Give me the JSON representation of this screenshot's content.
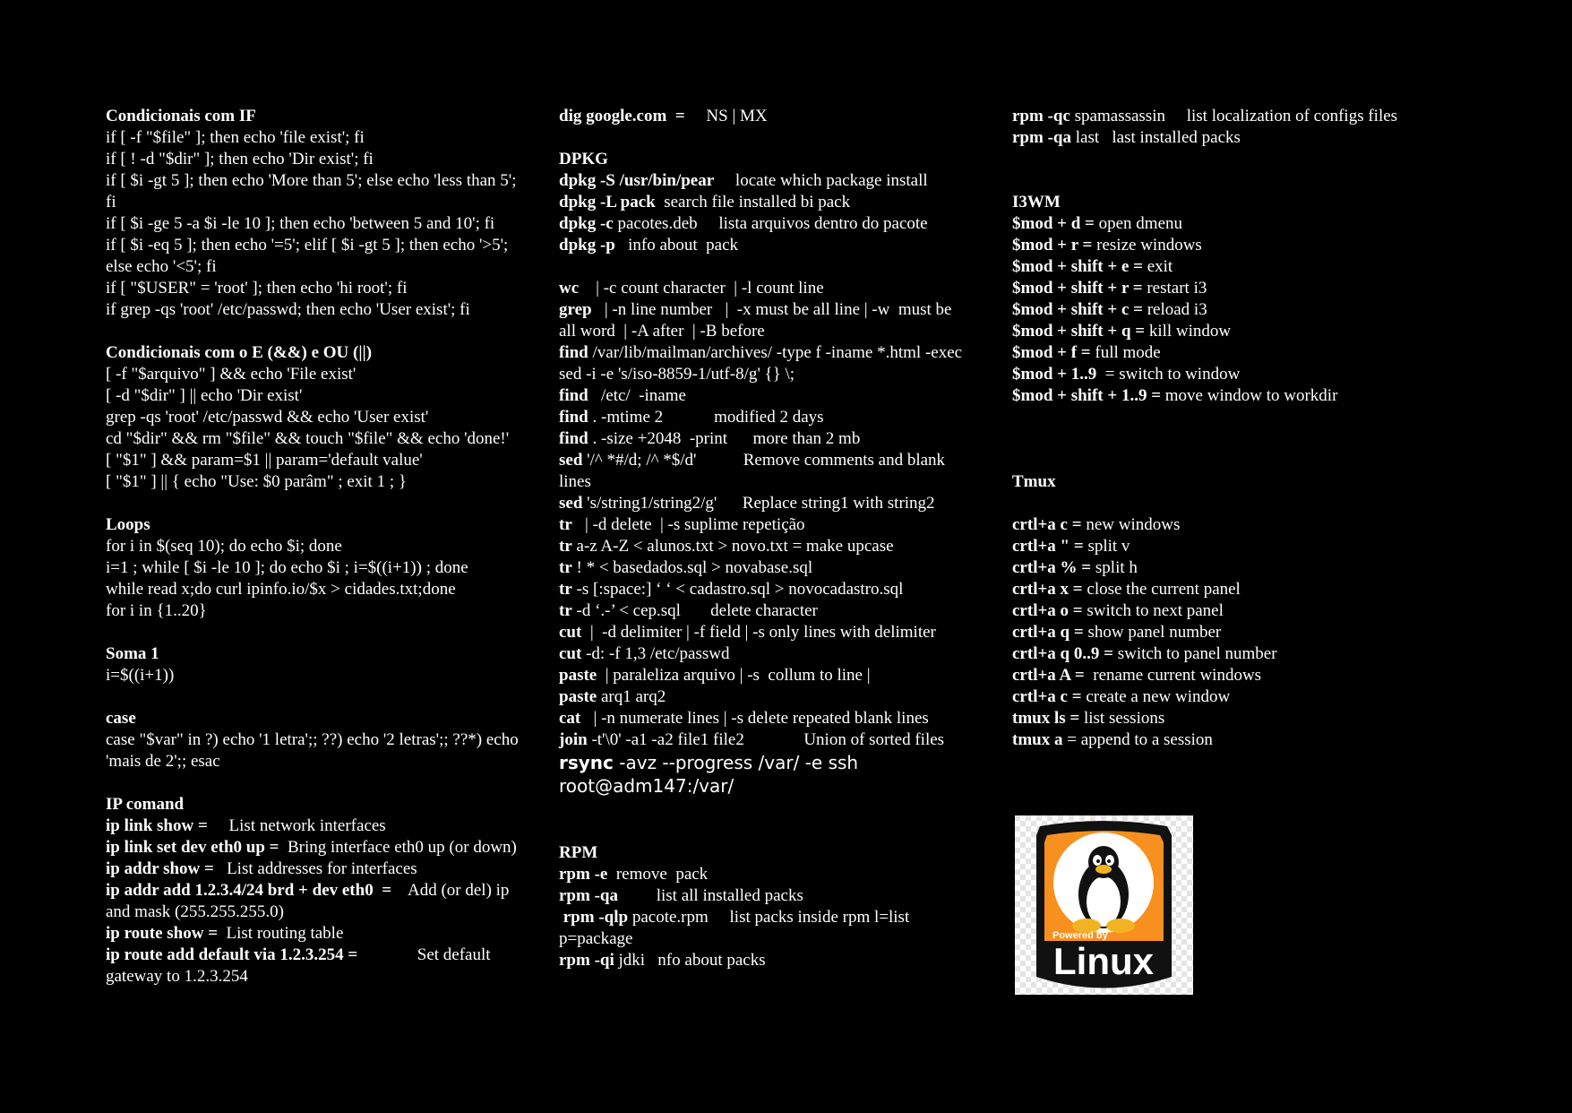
{
  "col1": {
    "lines": [
      {
        "b": "Condicionais com IF",
        "t": ""
      },
      {
        "b": "",
        "t": "if [ -f \"$file\" ]; then echo 'file exist'; fi"
      },
      {
        "b": "",
        "t": "if [ ! -d \"$dir\" ]; then echo 'Dir exist'; fi"
      },
      {
        "b": "",
        "t": "if [ $i -gt 5 ]; then echo 'More than 5'; else echo 'less than 5';"
      },
      {
        "b": "",
        "t": "fi"
      },
      {
        "b": "",
        "t": "if [ $i -ge 5 -a $i -le 10 ]; then echo 'between 5 and 10'; fi"
      },
      {
        "b": "",
        "t": "if [ $i -eq 5 ]; then echo '=5'; elif [ $i -gt 5 ]; then echo '>5';"
      },
      {
        "b": "",
        "t": "else echo '<5'; fi"
      },
      {
        "b": "",
        "t": "if [ \"$USER\" = 'root' ]; then echo 'hi root'; fi"
      },
      {
        "b": "",
        "t": "if grep -qs 'root' /etc/passwd; then echo 'User exist'; fi"
      },
      {
        "b": "",
        "t": ""
      },
      {
        "b": "Condicionais com o E (&&) e OU (||)",
        "t": ""
      },
      {
        "b": "",
        "t": "[ -f \"$arquivo\" ] && echo 'File exist'"
      },
      {
        "b": "",
        "t": "[ -d \"$dir\" ] || echo 'Dir exist'"
      },
      {
        "b": "",
        "t": "grep -qs 'root' /etc/passwd && echo 'User exist'"
      },
      {
        "b": "",
        "t": "cd \"$dir\" && rm \"$file\" && touch \"$file\" && echo 'done!'"
      },
      {
        "b": "",
        "t": "[ \"$1\" ] && param=$1 || param='default value'"
      },
      {
        "b": "",
        "t": "[ \"$1\" ] || { echo \"Use: $0 parâm\" ; exit 1 ; }"
      },
      {
        "b": "",
        "t": ""
      },
      {
        "b": "Loops",
        "t": ""
      },
      {
        "b": "",
        "t": "for i in $(seq 10); do echo $i; done"
      },
      {
        "b": "",
        "t": "i=1 ; while [ $i -le 10 ]; do echo $i ; i=$((i+1)) ; done"
      },
      {
        "b": "",
        "t": "while read x;do curl ipinfo.io/$x > cidades.txt;done"
      },
      {
        "b": "",
        "t": "for i in {1..20}"
      },
      {
        "b": "",
        "t": ""
      },
      {
        "b": "Soma 1",
        "t": ""
      },
      {
        "b": "",
        "t": "i=$((i+1))"
      },
      {
        "b": "",
        "t": ""
      },
      {
        "b": "case",
        "t": ""
      },
      {
        "b": "",
        "t": "case \"$var\" in ?) echo '1 letra';; ??) echo '2 letras';; ??*) echo"
      },
      {
        "b": "",
        "t": "'mais de 2';; esac"
      },
      {
        "b": "",
        "t": ""
      },
      {
        "b": "IP comand",
        "t": ""
      },
      {
        "b": "ip link show = ",
        "t": "    List network interfaces"
      },
      {
        "b": "ip link set dev eth0 up = ",
        "t": " Bring interface eth0 up (or down)"
      },
      {
        "b": "ip addr show = ",
        "t": "  List addresses for interfaces"
      },
      {
        "b": "ip addr add 1.2.3.4/24 brd + dev eth0  = ",
        "t": "   Add (or del) ip"
      },
      {
        "b": "",
        "t": "and mask (255.255.255.0)"
      },
      {
        "b": "ip route show = ",
        "t": " List routing table"
      },
      {
        "b": "ip route add default via 1.2.3.254 = ",
        "t": "             Set default"
      },
      {
        "b": "",
        "t": "gateway to 1.2.3.254"
      }
    ]
  },
  "col2": {
    "lines": [
      {
        "b": "dig google.com  = ",
        "t": "    NS | MX"
      },
      {
        "b": "",
        "t": ""
      },
      {
        "b": "DPKG",
        "t": ""
      },
      {
        "b": "dpkg -S /usr/bin/pear",
        "t": "     locate which package install"
      },
      {
        "b": "dpkg -L pack",
        "t": "  search file installed bi pack"
      },
      {
        "b": "dpkg -c",
        "t": " pacotes.deb     lista arquivos dentro do pacote"
      },
      {
        "b": "dpkg -p",
        "t": "   info about  pack"
      },
      {
        "b": "",
        "t": ""
      },
      {
        "b": "wc",
        "t": "    | -c count character  | -l count line"
      },
      {
        "b": "grep",
        "t": "   | -n line number   |  -x must be all line | -w  must be"
      },
      {
        "b": "",
        "t": "all word  | -A after  | -B before"
      },
      {
        "b": "find",
        "t": " /var/lib/mailman/archives/ -type f -iname *.html -exec"
      },
      {
        "b": "",
        "t": "sed -i -e 's/iso-8859-1/utf-8/g' {} \\;"
      },
      {
        "b": "find",
        "t": "   /etc/  -iname"
      },
      {
        "b": "find",
        "t": " . -mtime 2            modified 2 days"
      },
      {
        "b": "find",
        "t": " . -size +2048  -print      more than 2 mb"
      },
      {
        "b": "sed",
        "t": " '/^ *#/d; /^ *$/d'           Remove comments and blank"
      },
      {
        "b": "",
        "t": "lines"
      },
      {
        "b": "sed",
        "t": " 's/string1/string2/g'      Replace string1 with string2"
      },
      {
        "b": "tr",
        "t": "   | -d delete  | -s suplime repetição"
      },
      {
        "b": "tr",
        "t": " a-z A-Z < alunos.txt > novo.txt = make upcase"
      },
      {
        "b": "tr",
        "t": " ! * < basedados.sql > novabase.sql"
      },
      {
        "b": "tr",
        "t": " -s [:space:] ‘ ‘ < cadastro.sql > novocadastro.sql"
      },
      {
        "b": "tr",
        "t": " -d ‘.-’ < cep.sql       delete character"
      },
      {
        "b": "cut",
        "t": "  |  -d delimiter | -f field | -s only lines with delimiter"
      },
      {
        "b": "cut",
        "t": " -d: -f 1,3 /etc/passwd"
      },
      {
        "b": "paste",
        "t": "  | paraleliza arquivo | -s  collum to line |"
      },
      {
        "b": "paste",
        "t": " arq1 arq2"
      },
      {
        "b": "cat",
        "t": "   | -n numerate lines | -s delete repeated blank lines"
      },
      {
        "b": "join",
        "t": " -t'\\0' -a1 -a2 file1 file2              Union of sorted files"
      }
    ],
    "rsync": [
      {
        "b": "rsync",
        "t": " -avz --progress /var/ -e ssh"
      },
      {
        "b": "",
        "t": "root@adm147:/var/"
      }
    ],
    "rpm": [
      {
        "b": "RPM",
        "t": ""
      },
      {
        "b": "rpm -e",
        "t": "  remove  pack"
      },
      {
        "b": "rpm -qa",
        "t": "         list all installed packs"
      },
      {
        "b": " rpm -qlp",
        "t": " pacote.rpm     list packs inside rpm l=list"
      },
      {
        "b": "",
        "t": "p=package"
      },
      {
        "b": "rpm -qi",
        "t": " jdki   nfo about packs"
      }
    ]
  },
  "col3": {
    "lines": [
      {
        "b": "rpm -qc",
        "t": " spamassassin     list localization of configs files"
      },
      {
        "b": "rpm -qa",
        "t": " last   last installed packs"
      },
      {
        "b": "",
        "t": ""
      },
      {
        "b": "",
        "t": ""
      },
      {
        "b": "I3WM",
        "t": ""
      },
      {
        "b": "$mod + d =",
        "t": " open dmenu"
      },
      {
        "b": "$mod + r =",
        "t": " resize windows"
      },
      {
        "b": "$mod + shift + e =",
        "t": " exit"
      },
      {
        "b": "$mod + shift + r =",
        "t": " restart i3"
      },
      {
        "b": "$mod + shift + c =",
        "t": " reload i3"
      },
      {
        "b": "$mod + shift + q =",
        "t": " kill window"
      },
      {
        "b": "$mod + f =",
        "t": " full mode"
      },
      {
        "b": "$mod + 1..9 ",
        "t": " = switch to window"
      },
      {
        "b": "$mod + shift + 1..9 =",
        "t": " move window to workdir"
      },
      {
        "b": "",
        "t": ""
      },
      {
        "b": "",
        "t": ""
      },
      {
        "b": "",
        "t": ""
      },
      {
        "b": "Tmux",
        "t": ""
      },
      {
        "b": "",
        "t": ""
      },
      {
        "b": "crtl+a c =",
        "t": " new windows"
      },
      {
        "b": "crtl+a \" =",
        "t": " split v"
      },
      {
        "b": "crtl+a % =",
        "t": " split h"
      },
      {
        "b": "crtl+a x =",
        "t": " close the current panel"
      },
      {
        "b": "crtl+a o =",
        "t": " switch to next panel"
      },
      {
        "b": "crtl+a q =",
        "t": " show panel number"
      },
      {
        "b": "crtl+a q 0..9 =",
        "t": " switch to panel number"
      },
      {
        "b": "crtl+a A = ",
        "t": " rename current windows"
      },
      {
        "b": "crtl+a c =",
        "t": " create a new window"
      },
      {
        "b": "tmux ls =",
        "t": " list sessions"
      },
      {
        "b": "tmux a",
        "t": " = append to a session"
      }
    ]
  },
  "badge": {
    "powered_by": "Powered by",
    "brand": "Linux"
  },
  "colors": {
    "background": "#000000",
    "text": "#ffffff",
    "badge_orange": "#f7901e"
  }
}
